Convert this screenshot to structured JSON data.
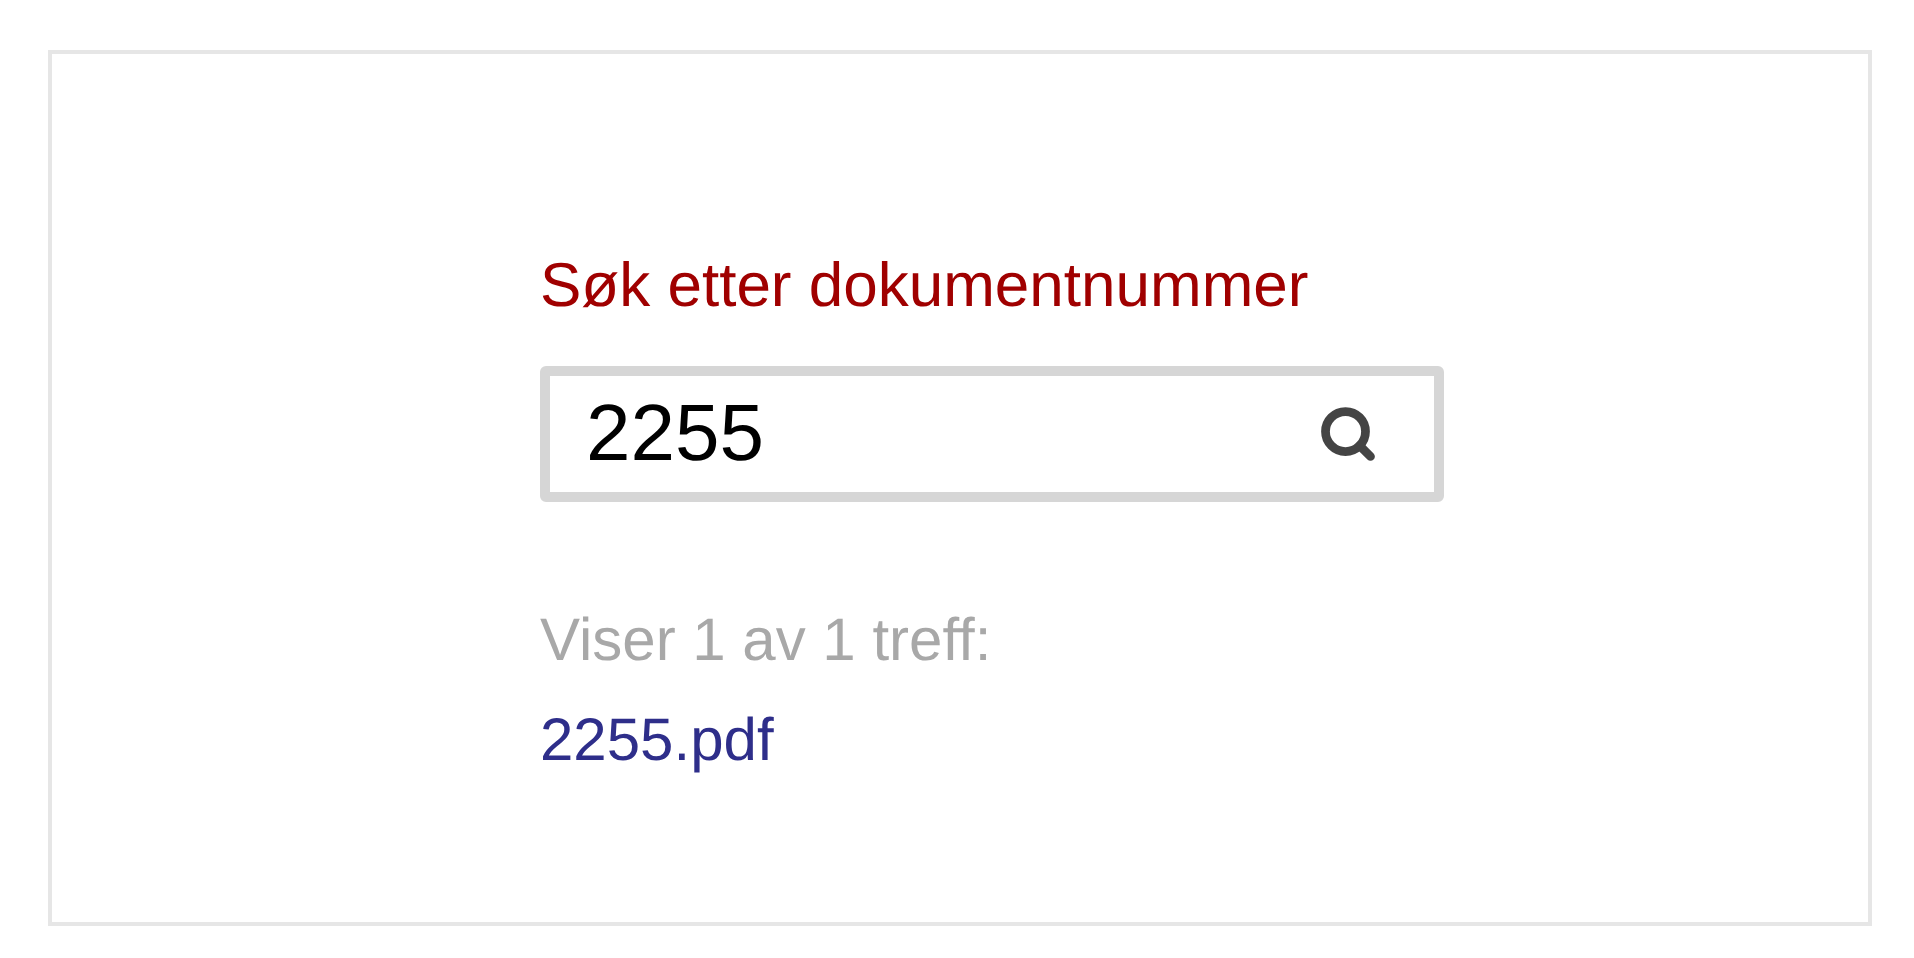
{
  "heading": "Søk etter dokumentnummer",
  "search": {
    "value": "2255"
  },
  "result_summary": "Viser 1 av 1 treff:",
  "results": [
    {
      "label": "2255.pdf"
    }
  ]
}
